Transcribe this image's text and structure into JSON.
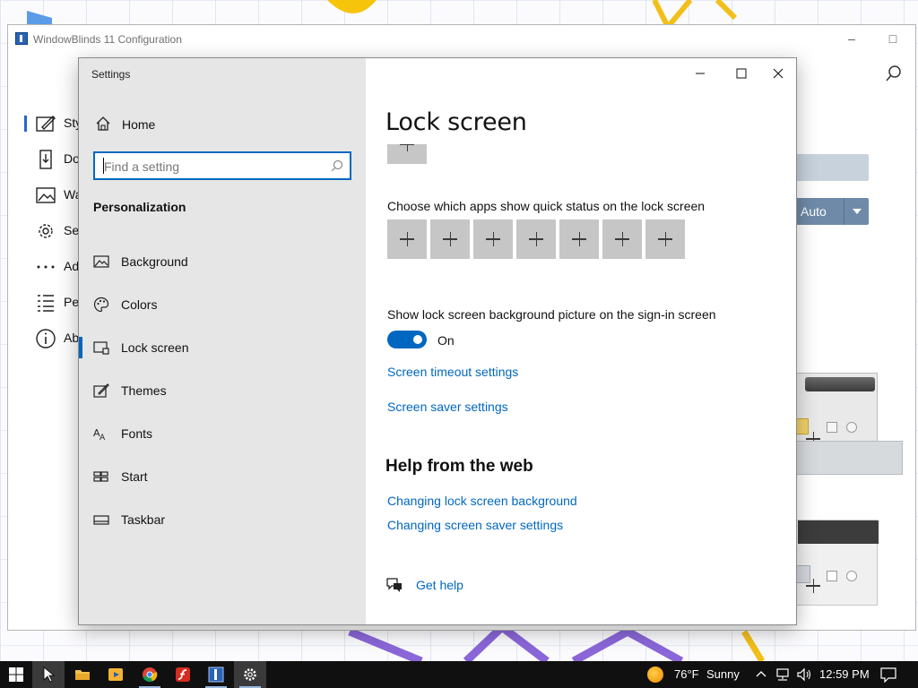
{
  "background_window": {
    "title": "WindowBlinds 11 Configuration",
    "nav_items": [
      {
        "label": "Sty",
        "icon": "styles-icon"
      },
      {
        "label": "Do",
        "icon": "download-icon"
      },
      {
        "label": "Wa",
        "icon": "wallpaper-icon"
      },
      {
        "label": "Se",
        "icon": "settings-gear-icon"
      },
      {
        "label": "Ad",
        "icon": "more-dots-icon"
      },
      {
        "label": "Pe",
        "icon": "performance-list-icon"
      },
      {
        "label": "Ab",
        "icon": "info-icon"
      }
    ],
    "auto_button": "Auto"
  },
  "settings_window": {
    "title": "Settings",
    "home_label": "Home",
    "search_placeholder": "Find a setting",
    "group_label": "Personalization",
    "nav_items": [
      {
        "label": "Background",
        "icon": "picture-icon",
        "selected": false
      },
      {
        "label": "Colors",
        "icon": "palette-icon",
        "selected": false
      },
      {
        "label": "Lock screen",
        "icon": "lock-screen-icon",
        "selected": true
      },
      {
        "label": "Themes",
        "icon": "themes-brush-icon",
        "selected": false
      },
      {
        "label": "Fonts",
        "icon": "fonts-icon",
        "selected": false
      },
      {
        "label": "Start",
        "icon": "start-grid-icon",
        "selected": false
      },
      {
        "label": "Taskbar",
        "icon": "taskbar-icon",
        "selected": false
      }
    ],
    "page_title": "Lock screen",
    "quick_status_label": "Choose which apps show quick status on the lock screen",
    "quick_status_slots": 7,
    "signin_bg_label": "Show lock screen background picture on the sign-in screen",
    "signin_toggle": {
      "state": "On",
      "on": true
    },
    "links": {
      "screen_timeout": "Screen timeout settings",
      "screen_saver": "Screen saver settings"
    },
    "help_section": {
      "title": "Help from the web",
      "links": [
        "Changing lock screen background",
        "Changing screen saver settings"
      ]
    },
    "get_help": "Get help"
  },
  "taskbar": {
    "apps": [
      "start-icon",
      "cursor-icon",
      "file-explorer-icon",
      "media-player-icon",
      "chrome-icon",
      "flash-icon",
      "windowblinds-icon",
      "settings-gear-icon"
    ],
    "weather": {
      "temp": "76°F",
      "condition": "Sunny"
    },
    "clock": "12:59 PM"
  },
  "colors": {
    "accent": "#0067c0",
    "sidebar_bg": "#e6e6e6",
    "tile_bg": "#c6c6c6",
    "taskbar_bg": "#101010"
  }
}
